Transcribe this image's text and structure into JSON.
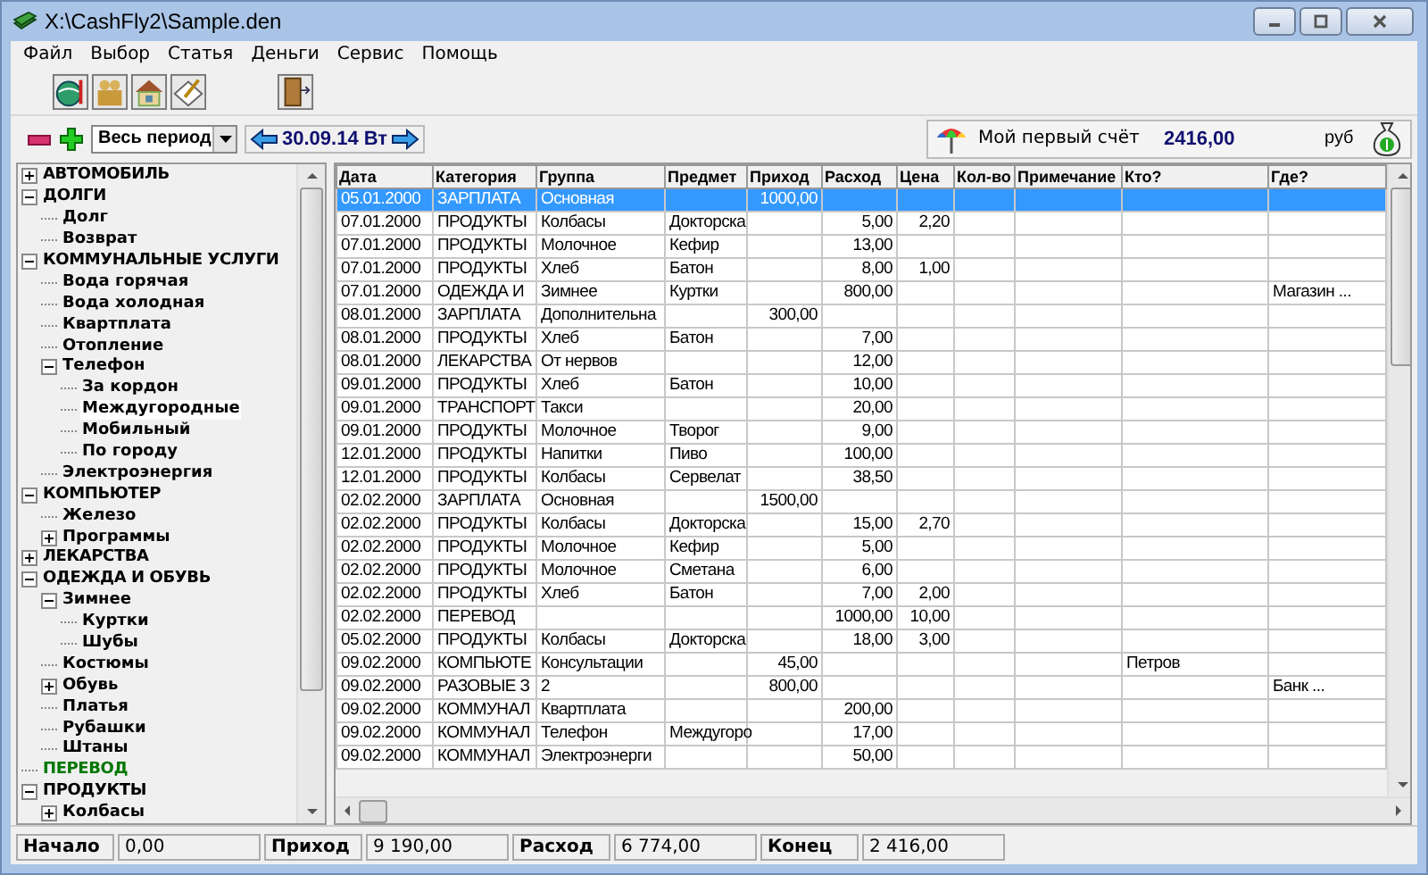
{
  "window": {
    "title": "X:\\CashFly2\\Sample.den"
  },
  "menu": [
    "Файл",
    "Выбор",
    "Статья",
    "Деньги",
    "Сервис",
    "Помощь"
  ],
  "period": {
    "value": "Весь период",
    "date": "30.09.14 Вт"
  },
  "account": {
    "name": "Мой первый счёт",
    "balance": "2416,00",
    "currency": "руб"
  },
  "tree": [
    {
      "label": "АВТОМОБИЛЬ",
      "color": "#000000",
      "expanded": false,
      "selected": false
    },
    {
      "label": "ДОЛГИ",
      "color": "#000000",
      "expanded": true,
      "selected": false,
      "children": [
        {
          "label": "Долг",
          "selected": false
        },
        {
          "label": "Возврат",
          "selected": false
        }
      ]
    },
    {
      "label": "КОММУНАЛЬНЫЕ УСЛУГИ",
      "color": "#000000",
      "expanded": true,
      "selected": false,
      "children": [
        {
          "label": "Вода горячая",
          "selected": false
        },
        {
          "label": "Вода холодная",
          "selected": false
        },
        {
          "label": "Квартплата",
          "selected": false
        },
        {
          "label": "Отопление",
          "selected": false
        },
        {
          "label": "Телефон",
          "expanded": true,
          "selected": false,
          "children": [
            {
              "label": "За кордон",
              "selected": false
            },
            {
              "label": "Междугородные",
              "selected": true
            },
            {
              "label": "Мобильный",
              "selected": false
            },
            {
              "label": "По городу",
              "selected": false
            }
          ]
        },
        {
          "label": "Электроэнергия",
          "selected": false
        }
      ]
    },
    {
      "label": "КОМПЬЮТЕР",
      "color": "#000000",
      "expanded": true,
      "selected": false,
      "children": [
        {
          "label": "Железо",
          "selected": false
        },
        {
          "label": "Программы",
          "expanded": false,
          "selected": false
        }
      ]
    },
    {
      "label": "ЛЕКАРСТВА",
      "color": "#000000",
      "expanded": false,
      "selected": false
    },
    {
      "label": "ОДЕЖДА И ОБУВЬ",
      "color": "#000000",
      "expanded": true,
      "selected": false,
      "children": [
        {
          "label": "Зимнее",
          "expanded": true,
          "selected": false,
          "children": [
            {
              "label": "Куртки",
              "selected": false
            },
            {
              "label": "Шубы",
              "selected": false
            }
          ]
        },
        {
          "label": "Костюмы",
          "selected": false
        },
        {
          "label": "Обувь",
          "expanded": false,
          "selected": false
        },
        {
          "label": "Платья",
          "selected": false
        },
        {
          "label": "Рубашки",
          "selected": false
        },
        {
          "label": "Штаны",
          "selected": false
        }
      ]
    },
    {
      "label": "ПЕРЕВОД",
      "color": "#007700",
      "selected": false
    },
    {
      "label": "ПРОДУКТЫ",
      "color": "#000000",
      "expanded": true,
      "selected": false,
      "children": [
        {
          "label": "Колбасы",
          "expanded": false,
          "selected": false
        }
      ]
    }
  ],
  "table": {
    "columns": [
      "Дата",
      "Категория",
      "Группа",
      "Предмет",
      "Приход",
      "Расход",
      "Цена",
      "Кол-во",
      "Примечание",
      "Кто?",
      "Где?"
    ],
    "rows": [
      {
        "date": "05.01.2000",
        "category": "ЗАРПЛАТА",
        "group": "Основная",
        "income": "1000,00",
        "selected": true
      },
      {
        "date": "07.01.2000",
        "category": "ПРОДУКТЫ",
        "group": "Колбасы",
        "item": "Докторска",
        "expense": "5,00",
        "price": "2,20",
        "selected": false
      },
      {
        "date": "07.01.2000",
        "category": "ПРОДУКТЫ",
        "group": "Молочное",
        "item": "Кефир",
        "expense": "13,00",
        "selected": false
      },
      {
        "date": "07.01.2000",
        "category": "ПРОДУКТЫ",
        "group": "Хлеб",
        "item": "Батон",
        "expense": "8,00",
        "price": "1,00",
        "selected": false
      },
      {
        "date": "07.01.2000",
        "category": "ОДЕЖДА И",
        "group": "Зимнее",
        "item": "Куртки",
        "expense": "800,00",
        "where": "Магазин ...",
        "selected": false
      },
      {
        "date": "08.01.2000",
        "category": "ЗАРПЛАТА",
        "group": "Дополнительна",
        "income": "300,00",
        "selected": false
      },
      {
        "date": "08.01.2000",
        "category": "ПРОДУКТЫ",
        "group": "Хлеб",
        "item": "Батон",
        "expense": "7,00",
        "selected": false
      },
      {
        "date": "08.01.2000",
        "category": "ЛЕКАРСТВА",
        "group": "От нервов",
        "expense": "12,00",
        "selected": false
      },
      {
        "date": "09.01.2000",
        "category": "ПРОДУКТЫ",
        "group": "Хлеб",
        "item": "Батон",
        "expense": "10,00",
        "selected": false
      },
      {
        "date": "09.01.2000",
        "category": "ТРАНСПОРТ",
        "group": "Такси",
        "expense": "20,00",
        "selected": false
      },
      {
        "date": "09.01.2000",
        "category": "ПРОДУКТЫ",
        "group": "Молочное",
        "item": "Творог",
        "expense": "9,00",
        "selected": false
      },
      {
        "date": "12.01.2000",
        "category": "ПРОДУКТЫ",
        "group": "Напитки",
        "item": "Пиво",
        "expense": "100,00",
        "selected": false
      },
      {
        "date": "12.01.2000",
        "category": "ПРОДУКТЫ",
        "group": "Колбасы",
        "item": "Сервелат",
        "expense": "38,50",
        "selected": false
      },
      {
        "date": "02.02.2000",
        "category": "ЗАРПЛАТА",
        "group": "Основная",
        "income": "1500,00",
        "selected": false
      },
      {
        "date": "02.02.2000",
        "category": "ПРОДУКТЫ",
        "group": "Колбасы",
        "item": "Докторска",
        "expense": "15,00",
        "price": "2,70",
        "selected": false
      },
      {
        "date": "02.02.2000",
        "category": "ПРОДУКТЫ",
        "group": "Молочное",
        "item": "Кефир",
        "expense": "5,00",
        "selected": false
      },
      {
        "date": "02.02.2000",
        "category": "ПРОДУКТЫ",
        "group": "Молочное",
        "item": "Сметана",
        "expense": "6,00",
        "selected": false
      },
      {
        "date": "02.02.2000",
        "category": "ПРОДУКТЫ",
        "group": "Хлеб",
        "item": "Батон",
        "expense": "7,00",
        "price": "2,00",
        "selected": false
      },
      {
        "date": "02.02.2000",
        "category": "ПЕРЕВОД",
        "expense": "1000,00",
        "price": "10,00",
        "selected": false
      },
      {
        "date": "05.02.2000",
        "category": "ПРОДУКТЫ",
        "group": "Колбасы",
        "item": "Докторска",
        "expense": "18,00",
        "price": "3,00",
        "selected": false
      },
      {
        "date": "09.02.2000",
        "category": "КОМПЬЮТЕ",
        "group": "Консультации",
        "income": "45,00",
        "who": "Петров",
        "selected": false
      },
      {
        "date": "09.02.2000",
        "category": "РАЗОВЫЕ З",
        "group": "2",
        "income": "800,00",
        "where": "Банк ...",
        "selected": false
      },
      {
        "date": "09.02.2000",
        "category": "КОММУНАЛ",
        "group": "Квартплата",
        "expense": "200,00",
        "selected": false
      },
      {
        "date": "09.02.2000",
        "category": "КОММУНАЛ",
        "group": "Телефон",
        "item": "Междугоро",
        "expense": "17,00",
        "selected": false
      },
      {
        "date": "09.02.2000",
        "category": "КОММУНАЛ",
        "group": "Электроэнерги",
        "expense": "50,00",
        "selected": false
      }
    ]
  },
  "status_bar": [
    {
      "label": "Начало",
      "value": "0,00"
    },
    {
      "label": "Приход",
      "value": "9 190,00"
    },
    {
      "label": "Расход",
      "value": "6 774,00"
    },
    {
      "label": "Конец",
      "value": "2 416,00"
    }
  ]
}
